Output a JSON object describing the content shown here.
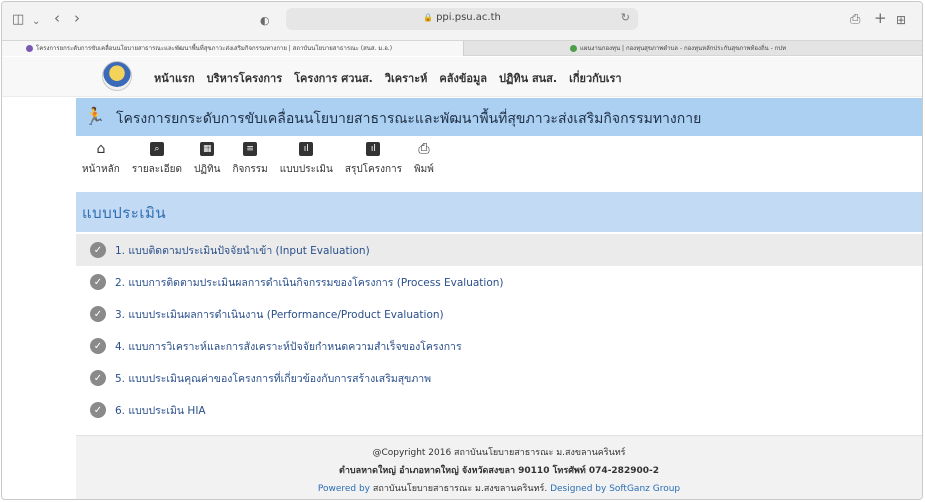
{
  "browser": {
    "url": "ppi.psu.ac.th",
    "tabs": [
      {
        "label": "โครงการยกระดับการขับเคลื่อนนโยบายสาธารณะและพัฒนาพื้นที่สุขภาวะส่งเสริมกิจกรรมทางกาย | สถาบันนโยบายสาธารณะ (สนส. ม.อ.)",
        "active": true
      },
      {
        "label": "แผนงานกองทุน | กองทุนสุขภาพตำบล - กองทุนหลักประกันสุขภาพท้องถิ่น - กปท",
        "active": false
      }
    ],
    "buttons": {
      "sidebar": "◫",
      "chevron": "⌄",
      "back": "‹",
      "forward": "›",
      "shield": "◐",
      "share": "⎙",
      "newtab": "+",
      "grid": "⊞"
    }
  },
  "nav": [
    "หน้าแรก",
    "บริหารโครงการ",
    "โครงการ ศวนส.",
    "วิเคราะห์",
    "คลังข้อมูล",
    "ปฏิทิน สนส.",
    "เกี่ยวกับเรา"
  ],
  "banner": {
    "title": "โครงการยกระดับการขับเคลื่อนนโยบายสาธารณะและพัฒนาพื้นที่สุขภาวะส่งเสริมกิจกรรมทางกาย"
  },
  "iconbar": [
    {
      "label": "หน้าหลัก",
      "icon": "home-icon",
      "glyph": "⌂"
    },
    {
      "label": "รายละเอียด",
      "icon": "search-icon",
      "glyph": "⌕"
    },
    {
      "label": "ปฏิทิน",
      "icon": "calendar-icon",
      "glyph": "▦"
    },
    {
      "label": "กิจกรรม",
      "icon": "clipboard-icon",
      "glyph": "≡"
    },
    {
      "label": "แบบประเมิน",
      "icon": "chart-icon",
      "glyph": "ıl"
    },
    {
      "label": "สรุปโครงการ",
      "icon": "chart-icon",
      "glyph": "ıl"
    },
    {
      "label": "พิมพ์",
      "icon": "print-icon",
      "glyph": "⎙"
    }
  ],
  "section": {
    "title": "แบบประเมิน"
  },
  "evaluations": [
    "1. แบบติดตามประเมินปัจจัยนำเข้า (Input Evaluation)",
    "2. แบบการติดตามประเมินผลการดำเนินกิจกรรมของโครงการ (Process Evaluation)",
    "3. แบบประเมินผลการดำเนินงาน (Performance/Product Evaluation)",
    "4. แบบการวิเคราะห์และการสังเคราะห์ปัจจัยกำหนดความสำเร็จของโครงการ",
    "5. แบบประเมินคุณค่าของโครงการที่เกี่ยวข้องกับการสร้างเสริมสุขภาพ",
    "6. แบบประเมิน HIA"
  ],
  "footer": {
    "copyright": "@Copyright 2016 สถาบันนโยบายสาธารณะ ม.สงขลานครินทร์",
    "address": "ตำบลหาดใหญ่ อำเภอหาดใหญ่ จังหวัดสงขลา 90110 โทรศัพท์ 074-282900-2",
    "powered_prefix": "Powered by",
    "powered_org": "สถาบันนโยบายสาธารณะ ม.สงขลานครินทร์.",
    "designed_prefix": "Designed by",
    "designed_by": "SoftGanz Group"
  },
  "colors": {
    "banner": "#abd0f2",
    "section": "#c3daf5",
    "link": "#2a4f8a"
  }
}
